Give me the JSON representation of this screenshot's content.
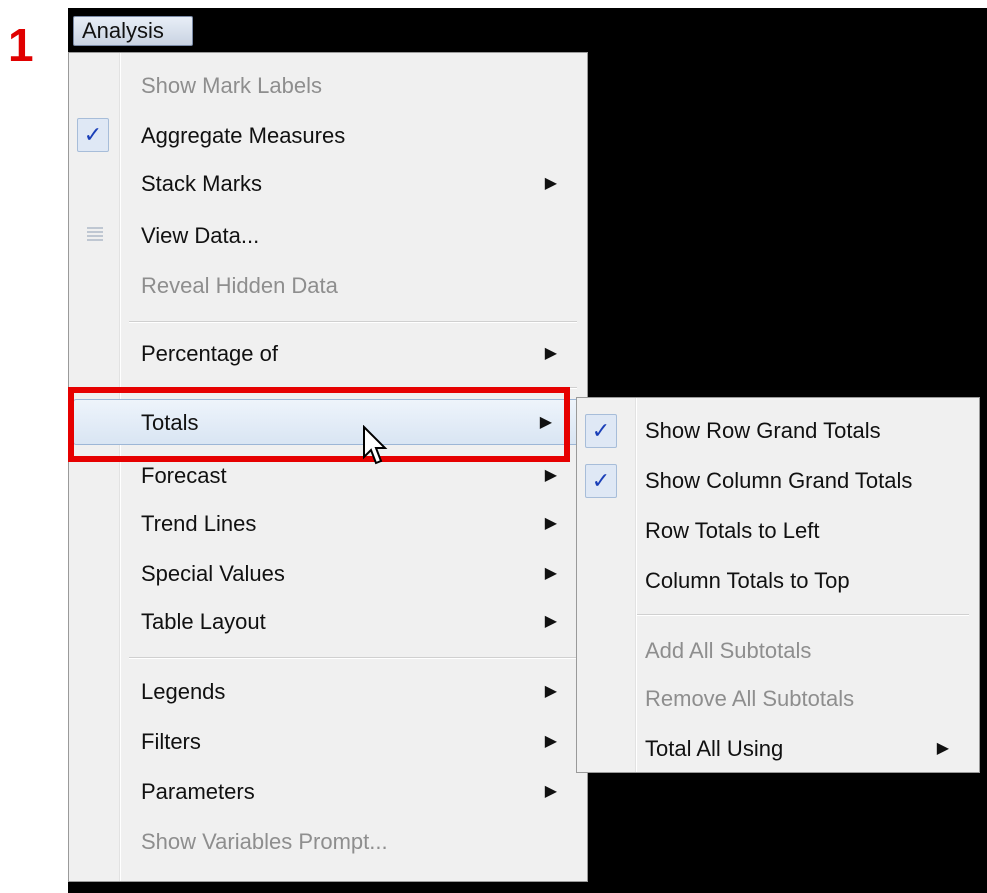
{
  "step_label": "1",
  "menubar": {
    "menu_title": "Analysis"
  },
  "analysis_menu": {
    "items": [
      {
        "label": "Show Mark Labels",
        "enabled": false,
        "checked": false,
        "submenu": false
      },
      {
        "label": "Aggregate Measures",
        "enabled": true,
        "checked": true,
        "submenu": false
      },
      {
        "label": "Stack Marks",
        "enabled": true,
        "checked": false,
        "submenu": true
      },
      {
        "label": "View Data...",
        "enabled": true,
        "checked": false,
        "submenu": false,
        "icon": "view-data-grid-icon"
      },
      {
        "label": "Reveal Hidden Data",
        "enabled": false,
        "checked": false,
        "submenu": false
      },
      {
        "label": "Percentage of",
        "enabled": true,
        "checked": false,
        "submenu": true
      },
      {
        "label": "Totals",
        "enabled": true,
        "checked": false,
        "submenu": true,
        "hovered": true
      },
      {
        "label": "Forecast",
        "enabled": true,
        "checked": false,
        "submenu": true
      },
      {
        "label": "Trend Lines",
        "enabled": true,
        "checked": false,
        "submenu": true
      },
      {
        "label": "Special Values",
        "enabled": true,
        "checked": false,
        "submenu": true
      },
      {
        "label": "Table Layout",
        "enabled": true,
        "checked": false,
        "submenu": true
      },
      {
        "label": "Legends",
        "enabled": true,
        "checked": false,
        "submenu": true
      },
      {
        "label": "Filters",
        "enabled": true,
        "checked": false,
        "submenu": true
      },
      {
        "label": "Parameters",
        "enabled": true,
        "checked": false,
        "submenu": true
      },
      {
        "label": "Show Variables Prompt...",
        "enabled": false,
        "checked": false,
        "submenu": false
      }
    ]
  },
  "totals_submenu": {
    "items": [
      {
        "label": "Show Row Grand Totals",
        "enabled": true,
        "checked": true,
        "submenu": false
      },
      {
        "label": "Show Column Grand Totals",
        "enabled": true,
        "checked": true,
        "submenu": false
      },
      {
        "label": "Row Totals to Left",
        "enabled": true,
        "checked": false,
        "submenu": false
      },
      {
        "label": "Column Totals to Top",
        "enabled": true,
        "checked": false,
        "submenu": false
      },
      {
        "label": "Add All Subtotals",
        "enabled": false,
        "checked": false,
        "submenu": false
      },
      {
        "label": "Remove All Subtotals",
        "enabled": false,
        "checked": false,
        "submenu": false
      },
      {
        "label": "Total All Using",
        "enabled": true,
        "checked": false,
        "submenu": true
      }
    ]
  },
  "glyphs": {
    "check": "✓",
    "arrow": "▶"
  },
  "colors": {
    "highlight_border": "#e60000",
    "step_label": "#e00000",
    "check": "#1a3fb8"
  }
}
